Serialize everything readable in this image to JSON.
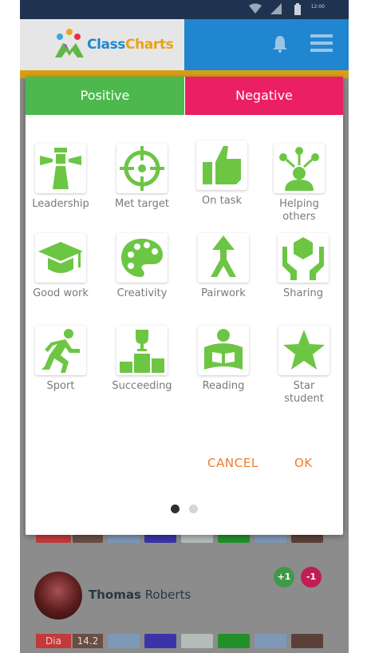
{
  "app": {
    "name_part1": "Class",
    "name_part2": "Charts",
    "colors": {
      "primary": "#1f86cf",
      "positive": "#4db84e",
      "negative": "#eb1f63",
      "accent": "#f07b2e",
      "icon": "#6cc644"
    }
  },
  "statusbar": {
    "time": "12:00"
  },
  "header": {
    "notification_icon": "bell-icon",
    "menu_icon": "hamburger-menu-icon"
  },
  "background": {
    "student": {
      "first_name": "Thomas",
      "last_name": "Roberts"
    },
    "badges": {
      "positive": "+1",
      "negative": "-1"
    },
    "tags": {
      "dia": "Dia",
      "score": "14.2"
    }
  },
  "modal": {
    "tabs": [
      {
        "label": "Positive",
        "selected": true
      },
      {
        "label": "Negative",
        "selected": false
      }
    ],
    "behaviours": [
      {
        "label": "Leadership",
        "icon": "lighthouse-icon"
      },
      {
        "label": "Met target",
        "icon": "crosshair-icon"
      },
      {
        "label": "On task",
        "icon": "thumbs-up-icon"
      },
      {
        "label": "Helping others",
        "icon": "network-person-icon"
      },
      {
        "label": "Good work",
        "icon": "graduation-cap-icon"
      },
      {
        "label": "Creativity",
        "icon": "palette-icon"
      },
      {
        "label": "Pairwork",
        "icon": "merge-arrow-icon"
      },
      {
        "label": "Sharing",
        "icon": "hands-hexagon-icon"
      },
      {
        "label": "Sport",
        "icon": "runner-icon"
      },
      {
        "label": "Succeeding",
        "icon": "podium-trophy-icon"
      },
      {
        "label": "Reading",
        "icon": "reading-person-icon"
      },
      {
        "label": "Star student",
        "icon": "star-icon"
      }
    ],
    "actions": {
      "cancel": "CANCEL",
      "ok": "OK"
    },
    "pagination": {
      "current_page": 1,
      "total_pages": 2
    }
  }
}
